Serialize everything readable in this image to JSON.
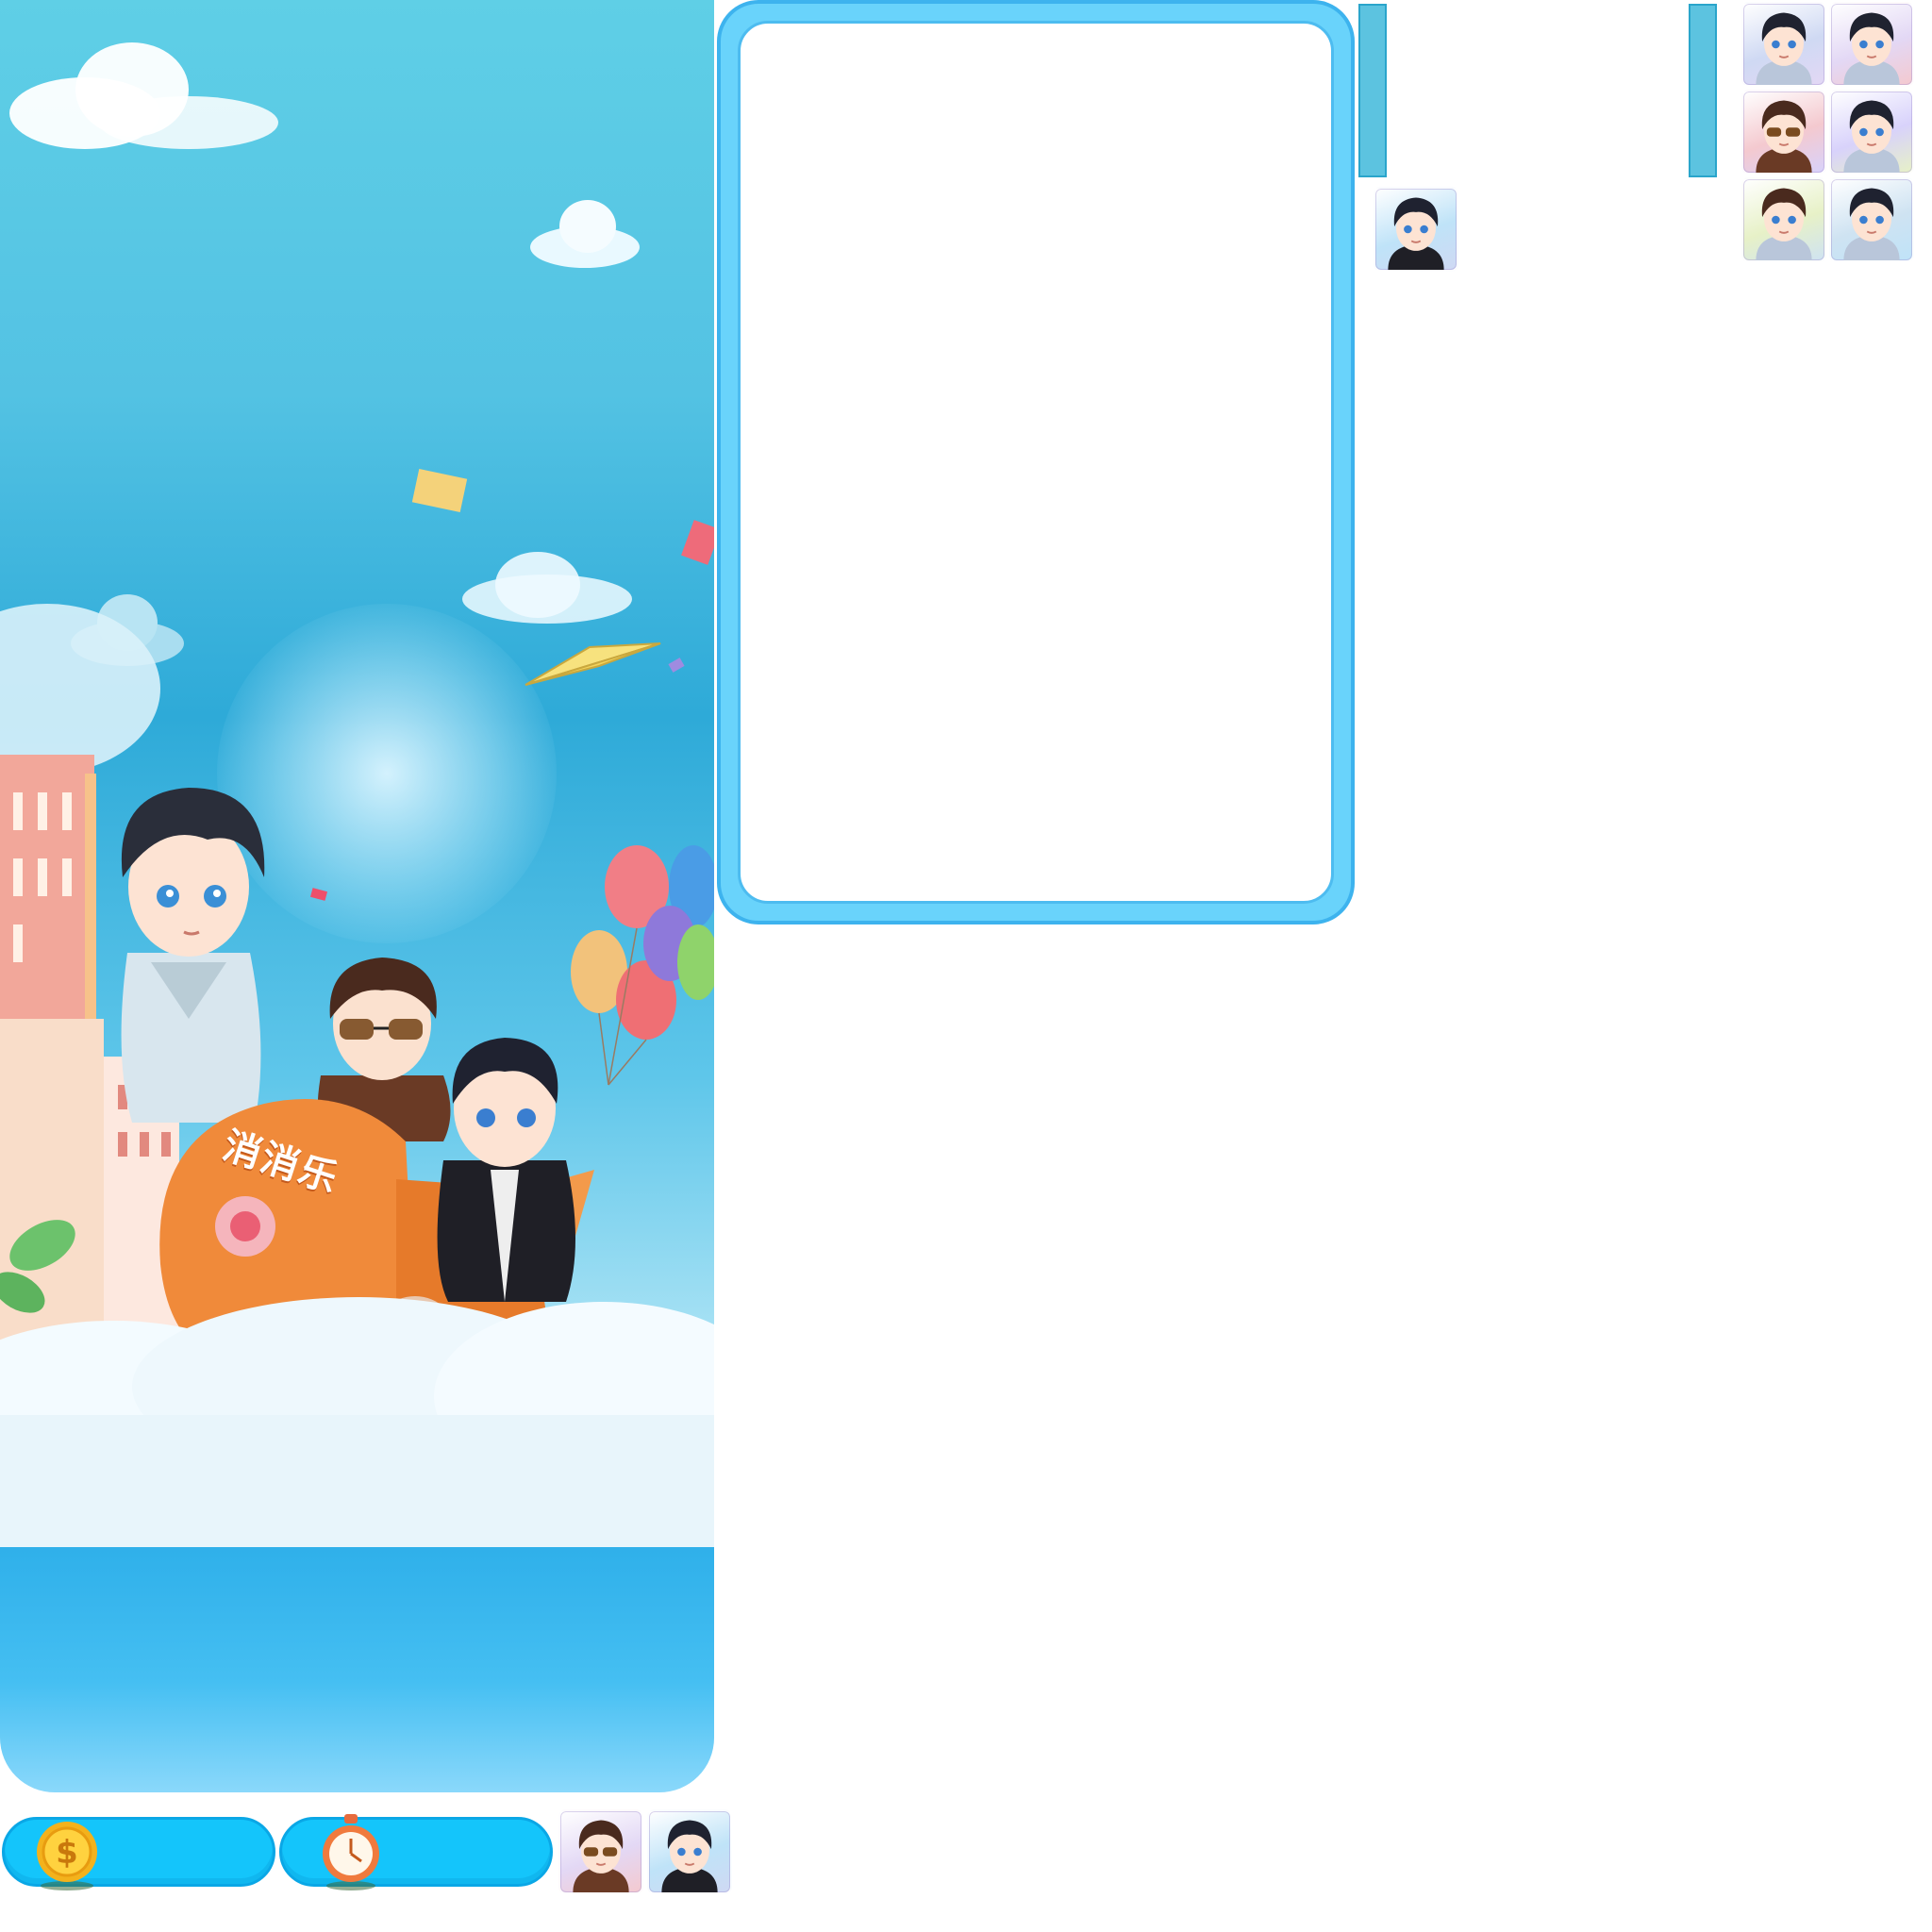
{
  "game": {
    "logo_text": "消消乐"
  },
  "hud": {
    "coins": {
      "icon": "dollar-coin-icon",
      "value": ""
    },
    "timer": {
      "icon": "stopwatch-icon",
      "value": ""
    }
  },
  "progress": {
    "left_bar": {
      "value": null
    },
    "right_bar": {
      "value": null
    }
  },
  "tiles": {
    "palette": [
      "#cfd9f3",
      "#e3d8f5",
      "#f4c9cf",
      "#d8d2fb",
      "#e7f1c7",
      "#cfe3f2",
      "#bfe3f8"
    ],
    "characters": [
      "char-black-hair-peace-sign",
      "char-black-hair-side-part",
      "char-sunglasses-brown-jacket",
      "char-black-hair-light-shirt",
      "char-brown-hair-smile",
      "char-black-hair-peace-sign-2",
      "char-black-hair-black-jacket"
    ]
  },
  "colors": {
    "board_border": "#3db3ee",
    "pill_fill": "#14c5fb",
    "sky_top": "#5fcfe6",
    "sky_bottom": "#2fb0ea"
  }
}
